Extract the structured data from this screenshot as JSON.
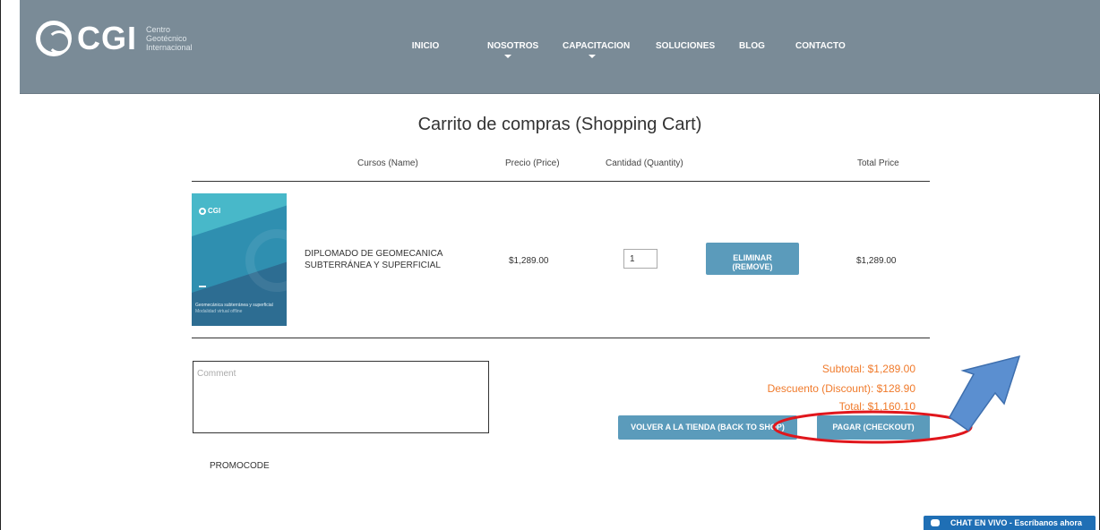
{
  "header": {
    "logo_text": "CGI",
    "logo_sub": [
      "Centro",
      "Geotécnico",
      "Internacional"
    ],
    "nav": [
      {
        "label": "INICIO",
        "caret": false
      },
      {
        "label": "NOSOTROS",
        "caret": true
      },
      {
        "label": "CAPACITACION",
        "caret": true
      },
      {
        "label": "SOLUCIONES",
        "caret": false
      },
      {
        "label": "BLOG",
        "caret": false
      },
      {
        "label": "CONTACTO",
        "caret": false
      }
    ]
  },
  "cart": {
    "title": "Carrito de compras (Shopping Cart)",
    "columns": {
      "name": "Cursos (Name)",
      "price": "Precio (Price)",
      "quantity": "Cantidad (Quantity)",
      "total": "Total Price"
    },
    "item": {
      "name_line1": "DIPLOMADO DE GEOMECANICA",
      "name_line2": "SUBTERRÁNEA Y SUPERFICIAL",
      "price": "$1,289.00",
      "quantity": "1",
      "remove_line1": "ELIMINAR",
      "remove_line2": "(REMOVE)",
      "total": "$1,289.00",
      "thumb_logo": "CGI",
      "thumb_caption": "Geomecánica subterránea y superficial",
      "thumb_caption2": "Modalidad virtual offline"
    },
    "comment_placeholder": "Comment",
    "subtotal": "Subtotal: $1,289.00",
    "discount": "Descuento (Discount): $128.90",
    "total": "Total: $1,160.10",
    "back_button": "VOLVER A LA TIENDA (BACK TO SHOP)",
    "checkout_button": "PAGAR (CHECKOUT)",
    "promocode_label": "PROMOCODE"
  },
  "chat": {
    "label": "CHAT EN VIVO - Escríbanos ahora"
  },
  "colors": {
    "header_bg": "#7a8b97",
    "button_bg": "#5b9bbb",
    "summary_text": "#f07a2b",
    "annotation_red": "#e0161c",
    "annotation_arrow": "#5b8fd0",
    "chat_bg": "#1f6fb5"
  }
}
